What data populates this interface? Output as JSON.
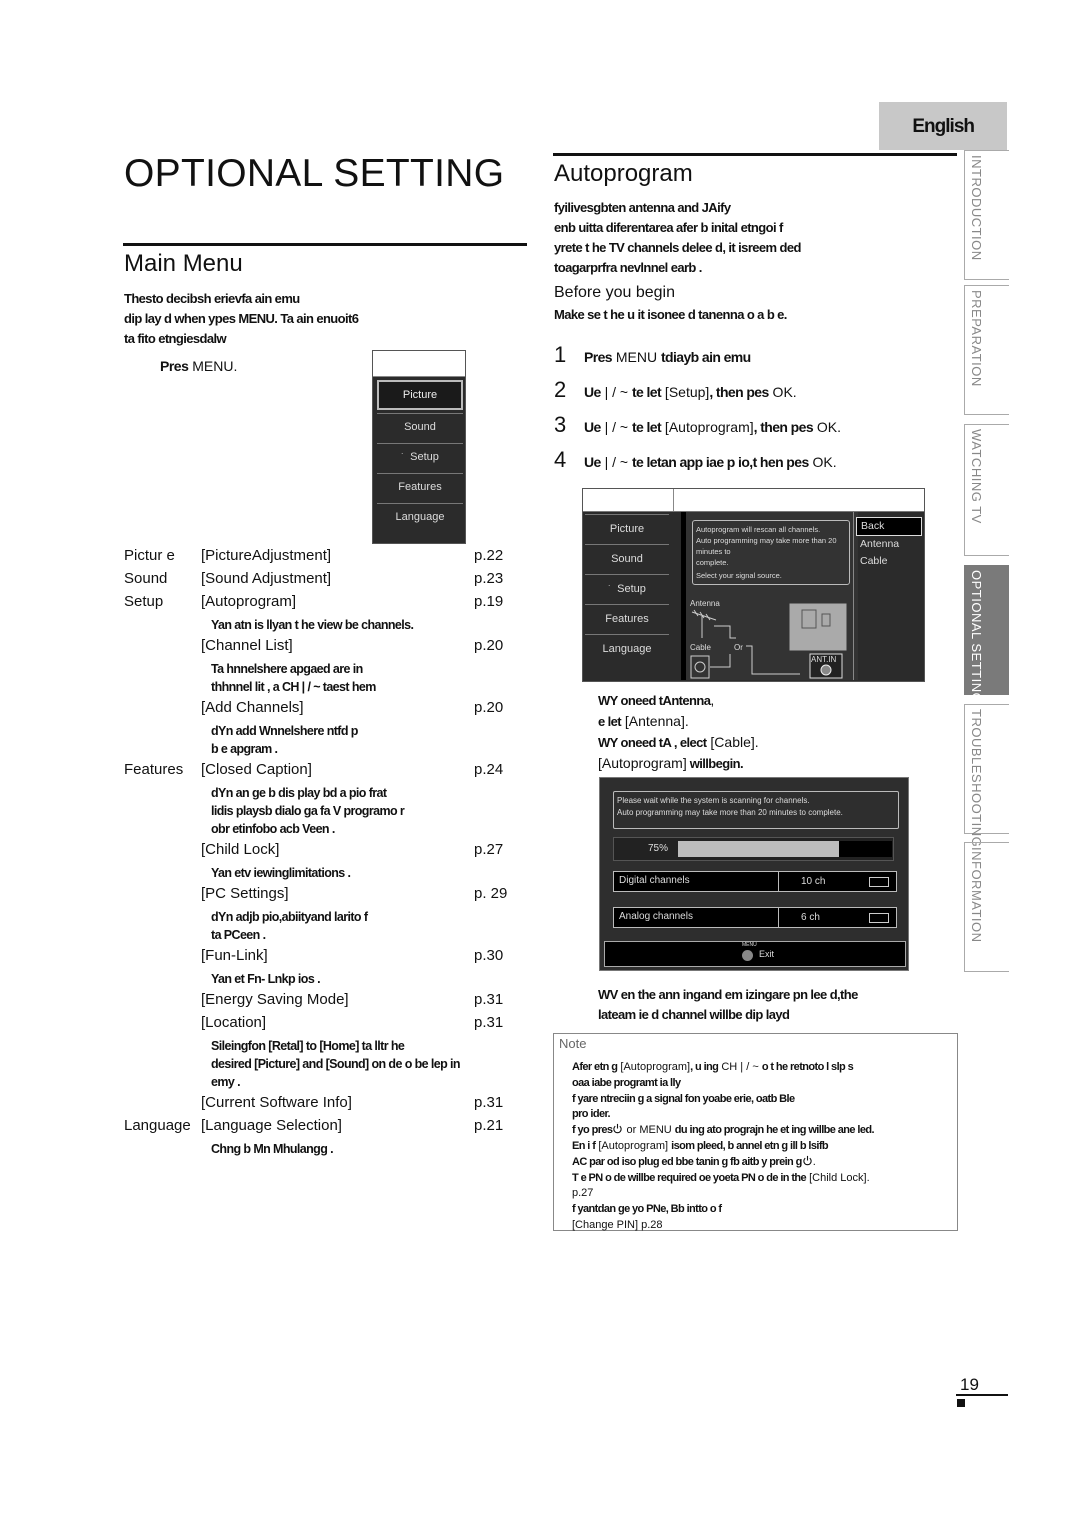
{
  "header": {
    "language_tab": "English",
    "page_title": "OPTIONAL SETTING"
  },
  "side_tabs": [
    {
      "label": "INTRODUCTION",
      "active": false
    },
    {
      "label": "PREPARATION",
      "active": false
    },
    {
      "label": "WATCHING TV",
      "active": false
    },
    {
      "label": "OPTIONAL SETTING",
      "active": true
    },
    {
      "label": "TROUBLESHOOTING",
      "active": false
    },
    {
      "label": "INFORMATION",
      "active": false
    }
  ],
  "main_menu": {
    "heading": "Main Menu",
    "intro_lines": [
      "Thesto decibsh erievfa ain emu",
      "dip lay d when ypes      MENU. Ta ain enuoit6",
      "ta fito etngiesdalw"
    ],
    "press_prefix": "Pres",
    "press_key": "MENU.",
    "screen_items": [
      {
        "label": "Picture",
        "selected": true,
        "marker": ""
      },
      {
        "label": "Sound",
        "selected": false,
        "marker": ""
      },
      {
        "label": "Setup",
        "selected": false,
        "marker": "˙"
      },
      {
        "label": "Features",
        "selected": false,
        "marker": ""
      },
      {
        "label": "Language",
        "selected": false,
        "marker": ""
      }
    ],
    "rows": [
      {
        "category": "Pictur e",
        "item": "[PictureAdjustment]",
        "page": "p.22",
        "desc": []
      },
      {
        "category": "Sound",
        "item": "[Sound Adjustment]",
        "page": "p.23",
        "desc": []
      },
      {
        "category": "Setup",
        "item": "[Autoprogram]",
        "page": "p.19",
        "desc": [
          "Yan atn       is llyan t he view be channels."
        ]
      },
      {
        "category": "",
        "item": "[Channel List]",
        "page": "p.20",
        "desc": [
          "Ta hnnelshere apgaed are in",
          "thhnnel lit     , a  CH | / ~ taest        hem"
        ]
      },
      {
        "category": "",
        "item": "[Add Channels]",
        "page": "p.20",
        "desc": [
          "dYn add     Wnnelshere ntfd p",
          "b e apgram         ."
        ]
      },
      {
        "category": "Features",
        "item": "[Closed Caption]",
        "page": "p.24",
        "desc": [
          "dYn an        ge b dis play bd a      pio frat",
          "lidis      playsb dialo  ga fa V       programo r",
          "obr etinfobo acb Veen                 ."
        ]
      },
      {
        "category": "",
        "item": "[Child Lock]",
        "page": "p.27",
        "desc": [
          "Yan etv     iewinglimitations ."
        ]
      },
      {
        "category": "",
        "item": "[PC Settings]",
        "page": "p. 29",
        "desc": [
          "dYn adjb pio,abiityand larito                      f",
          "ta PCeen    ."
        ]
      },
      {
        "category": "",
        "item": "[Fun-Link]",
        "page": "p.30",
        "desc": [
          "Yan et      Fn- Lnkp  ios ."
        ]
      },
      {
        "category": "",
        "item": "[Energy Saving Mode]",
        "page": "p.31",
        "desc": []
      },
      {
        "category": "",
        "item": "[Location]",
        "page": "p.31",
        "desc": [
          "Sileingfon           [Retal] to [Home] ta  lltr   he",
          "desired [Picture] and [Sound] on de o be lep in",
          "emy    ."
        ]
      },
      {
        "category": "",
        "item": "[Current Software Info]",
        "page": "p.31",
        "desc": []
      },
      {
        "category": "Language",
        "item": "[Language Selection]",
        "page": "p.21",
        "desc": [
          "Chng b Mn Mhulangg          ."
        ]
      }
    ]
  },
  "autoprogram": {
    "heading": "Autoprogram",
    "intro_lines": [
      "fyilivesgbten antenna and JAify",
      "enb uitta diferentarea afer b inital etngoi                  f",
      "yrete t     he TV     channels     delee d, it isreem          ded",
      "toagarprfra nevlnnel earb                               ."
    ],
    "before_heading": "Before you begin",
    "before_text": "Make se t  he u it isonee      d tanenna o a      b e.",
    "steps": [
      {
        "num": "1",
        "bold_a": "Pres",
        "plain_a": " MENU ",
        "bold_b": "tdiayb ain emu",
        "plain_b": ""
      },
      {
        "num": "2",
        "bold_a": "Ue",
        "plain_a": " | / ~ ",
        "bold_b": "te   let",
        "plain_b": " [Setup]",
        "bold_c": ", then pes",
        "plain_c": " OK."
      },
      {
        "num": "3",
        "bold_a": "Ue",
        "plain_a": " | / ~ ",
        "bold_b": "te   let",
        "plain_b": " [Autoprogram]",
        "bold_c": ", then pes",
        "plain_c": " OK."
      },
      {
        "num": "4",
        "bold_a": "Ue",
        "plain_a": " | / ~ ",
        "bold_b": "te   letan app       iae p  io,t  hen pes",
        "plain_b": " OK.",
        "bold_c": "",
        "plain_c": ""
      }
    ],
    "source_screen": {
      "menu_items": [
        {
          "label": "Picture",
          "marker": ""
        },
        {
          "label": "Sound",
          "marker": ""
        },
        {
          "label": "Setup",
          "marker": "˙"
        },
        {
          "label": "Features",
          "marker": ""
        },
        {
          "label": "Language",
          "marker": ""
        }
      ],
      "message_lines": [
        "Autoprogram will rescan all channels.",
        "Auto programming may take more than 20 minutes to",
        "complete.",
        "Select your signal source."
      ],
      "options": [
        {
          "label": "Back",
          "selected": true
        },
        {
          "label": "Antenna",
          "selected": false
        },
        {
          "label": "Cable",
          "selected": false
        }
      ],
      "diagram_labels": {
        "antenna": "Antenna",
        "cable": "Cable",
        "or": "Or",
        "ant_in": "ANT.IN"
      }
    },
    "after_screen": {
      "line1_bold": "WY oneed tAntenna",
      "line1_plain": ",",
      "line2_bold": "e let",
      "line2_plain": " [Antenna].",
      "line3_bold": "WY oneed tA                  , elect",
      "line3_plain": " [Cable].",
      "line4_plain": "[Autoprogram]",
      "line4_bold": " willbegin."
    },
    "scan_screen": {
      "message_lines": [
        "Please wait while the system is scanning for channels.",
        "Auto programming may take more than 20 minutes to complete."
      ],
      "progress_label": "75%",
      "progress_fraction": 0.75,
      "channels": [
        {
          "label": "Digital channels",
          "value": "10 ch"
        },
        {
          "label": "Analog channels",
          "value": "6 ch"
        }
      ],
      "exit_key": "MENU",
      "exit_label": "Exit"
    },
    "scan_done_lines": [
      "WV en the ann ingand em      izingare pn       lee d,the",
      "lateam              ie d channel willbe dip layd"
    ]
  },
  "note": {
    "title": "Note",
    "items": [
      {
        "bold": "Afer etn  g",
        "plain": " [Autoprogram]",
        "rest_bold": ", u ing",
        "rest_plain": " CH | / ~ ",
        "tail_bold": "o t he retnoto       l slp s"
      },
      {
        "bold": "oaa  iabe programt          ia lly",
        "plain": ""
      },
      {
        "bold": "f yare ntreciin      g a signal fon yoabe erie, oatb Ble",
        "plain": ""
      },
      {
        "bold": "pro ider.",
        "plain": ""
      },
      {
        "bold": "f yo  pres",
        "icon": "power",
        "plain": " or MENU ",
        "rest_bold": "du ing ato  prograjn he et ing willbe ane led."
      },
      {
        "bold": "En i  f",
        "plain": " [Autoprogram] ",
        "rest_bold": "isom   pleed, b annel etn      g ill b lsifb"
      },
      {
        "bold": "AC par od iso        plug ed bbe tanin    g fb aitb        y prein g",
        "icon": "power",
        "plain": "."
      },
      {
        "bold": "T e PN o de willbe required oe    yoeta      PN o de in the",
        "plain": " [Child Lock]."
      },
      {
        "bold": "",
        "plain": "   p.27"
      },
      {
        "bold": "f yantdan           ge yo PNe, Bb intto o                      f",
        "plain": ""
      },
      {
        "bold": "",
        "plain": "[Change PIN]    p.28"
      }
    ]
  },
  "footer": {
    "page_number": "19"
  }
}
